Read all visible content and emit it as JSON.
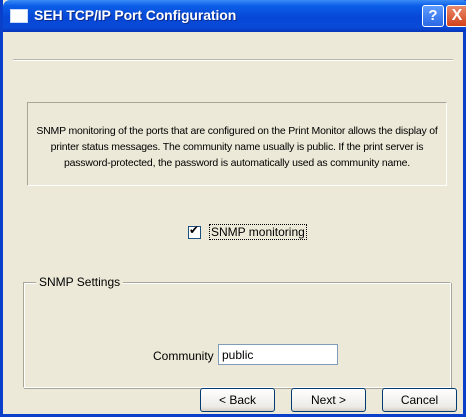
{
  "window": {
    "title": "SEH TCP/IP Port Configuration",
    "help_glyph": "?",
    "close_glyph": "X"
  },
  "info": {
    "text": "SNMP monitoring of the ports that are configured on the Print Monitor allows the display of printer status messages. The community name usually is public. If the print server is password-protected, the password is automatically used as community name."
  },
  "snmp_monitoring": {
    "label": "SNMP monitoring",
    "checked": true,
    "check_glyph": "✔"
  },
  "settings": {
    "group_label": "SNMP Settings",
    "community_label": "Community",
    "community_value": "public"
  },
  "buttons": {
    "back": "< Back",
    "next": "Next >",
    "cancel": "Cancel"
  },
  "colors": {
    "titlebar": "#0747d6",
    "window_bg": "#ece9d8",
    "close": "#d2421b"
  },
  "icons": {
    "app": "window-icon",
    "help": "help-icon",
    "close": "close-icon"
  }
}
